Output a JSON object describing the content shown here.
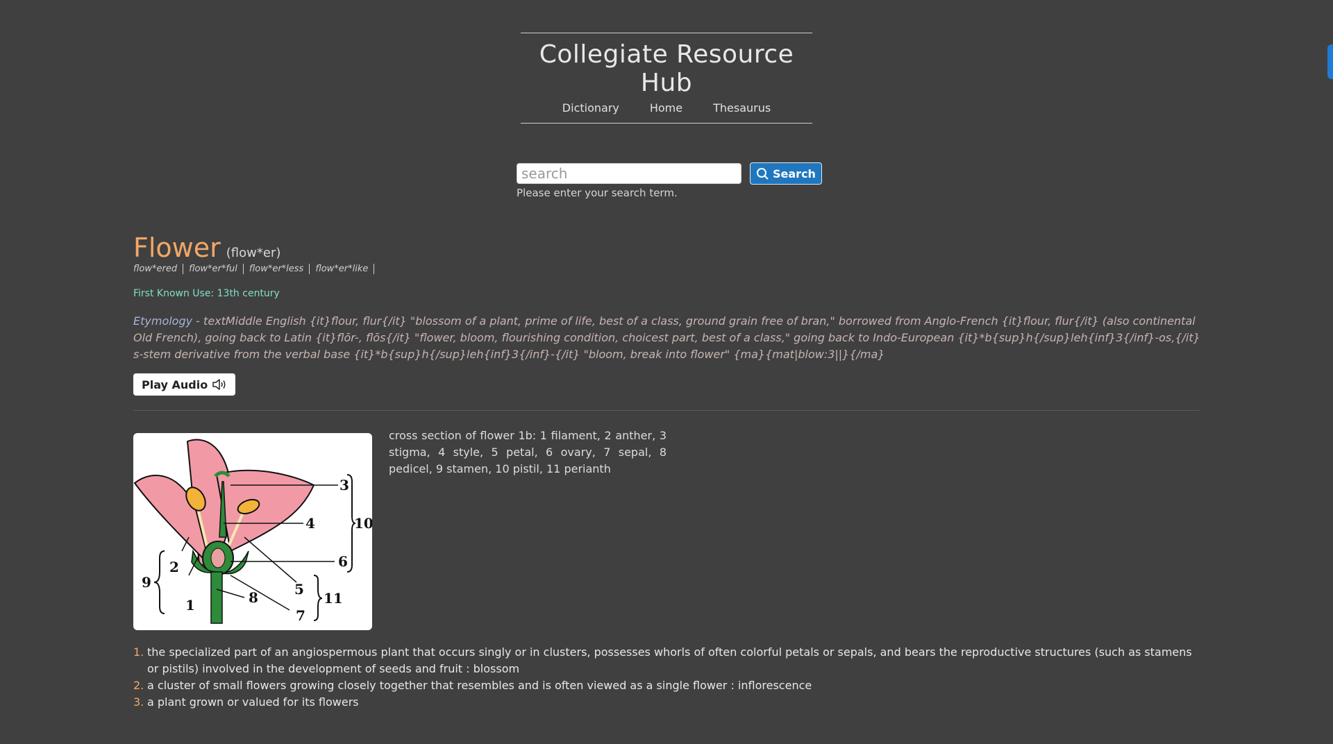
{
  "site": {
    "title": "Collegiate Resource Hub",
    "nav": [
      "Dictionary",
      "Home",
      "Thesaurus"
    ]
  },
  "search": {
    "placeholder": "search",
    "button_label": "Search",
    "hint": "Please enter your search term."
  },
  "entry": {
    "headword": "Flower",
    "pronunciation": "(flow*er)",
    "forms": [
      "flow*ered",
      "flow*er*ful",
      "flow*er*less",
      "flow*er*like"
    ],
    "first_known_use": "First Known Use: 13th century",
    "etymology_label": "Etymology",
    "etymology_text": " - textMiddle English {it}flour, flur{/it} \"blossom of a plant, prime of life, best of a class, ground grain free of bran,\" borrowed from Anglo-French {it}flour, flur{/it} (also continental Old French), going back to Latin {it}flōr-, flōs{/it} \"flower, bloom, flourishing condition, choicest part, best of a class,\" going back to Indo-European {it}*b{sup}h{/sup}leh{inf}3{/inf}-os,{/it} s-stem derivative from the verbal base {it}*b{sup}h{/sup}leh{inf}3{/inf}-{/it} \"bloom, break into flower\" {ma}{mat|blow:3||}{/ma}",
    "play_audio_label": "Play Audio",
    "image_caption": "cross section of flower 1b: 1 filament, 2 anther, 3 stigma, 4 style, 5 petal, 6 ovary, 7 sepal, 8 pedicel, 9 stamen, 10 pistil, 11 perianth",
    "diagram_labels": [
      "1",
      "2",
      "3",
      "4",
      "5",
      "6",
      "7",
      "8",
      "9",
      "10",
      "11"
    ],
    "definitions": [
      {
        "num": "1.",
        "text": "the specialized part of an angiospermous plant that occurs singly or in clusters, possesses whorls of often colorful petals or sepals, and bears the reproductive structures (such as stamens or pistils) involved in the development of seeds and fruit : blossom"
      },
      {
        "num": "2.",
        "text": "a cluster of small flowers growing closely together that resembles and is often viewed as a single flower : inflorescence"
      },
      {
        "num": "3.",
        "text": "a plant grown or valued for its flowers"
      }
    ]
  },
  "colors": {
    "background": "#404040",
    "headword": "#f0a868",
    "first_use": "#7fe0c8",
    "accent_button": "#1f78bf"
  }
}
